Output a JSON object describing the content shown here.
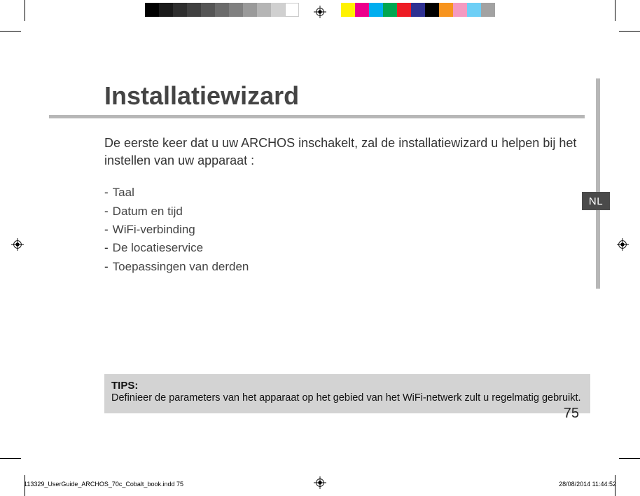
{
  "colorBar": {
    "swatches": [
      "#000000",
      "#1a1a1a",
      "#2e2e2e",
      "#404040",
      "#555555",
      "#6b6b6b",
      "#808080",
      "#9a9a9a",
      "#b5b5b5",
      "#d0d0d0",
      "#ffffff",
      "",
      "",
      "",
      "#fff200",
      "#ec008c",
      "#00aeef",
      "#00a651",
      "#ed1c24",
      "#2e3192",
      "#000000",
      "#f7941e",
      "#f49ac1",
      "#6dcff6",
      "#a2a2a2"
    ]
  },
  "langTab": "NL",
  "title": "Installatiewizard",
  "intro": "De eerste keer dat u uw ARCHOS inschakelt, zal de installatiewizard u helpen bij het instellen van uw apparaat :",
  "list": [
    "Taal",
    "Datum en tijd",
    "WiFi-verbinding",
    "De locatieservice",
    "Toepassingen van derden"
  ],
  "tips": {
    "label": "TIPS:",
    "text": "Definieer de parameters van het apparaat op het gebied van het WiFi-netwerk zult u regelmatig gebruikt."
  },
  "pageNumber": "75",
  "footer": {
    "left": "113329_UserGuide_ARCHOS_70c_Cobalt_book.indd   75",
    "right": "28/08/2014   11:44:52"
  }
}
